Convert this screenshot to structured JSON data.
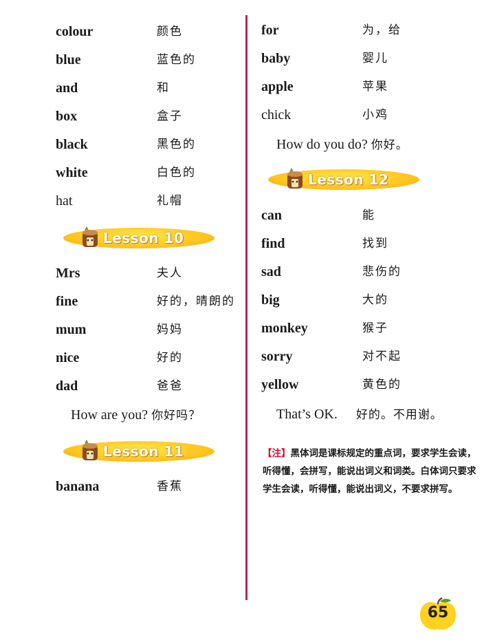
{
  "left_column": {
    "words_top": [
      {
        "en": "colour",
        "zh": "颜色",
        "bold": true
      },
      {
        "en": "blue",
        "zh": "蓝色的",
        "bold": true
      },
      {
        "en": "and",
        "zh": "和",
        "bold": true
      },
      {
        "en": "box",
        "zh": "盒子",
        "bold": true
      },
      {
        "en": "black",
        "zh": "黑色的",
        "bold": true
      },
      {
        "en": "white",
        "zh": "白色的",
        "bold": true
      },
      {
        "en": "hat",
        "zh": "礼帽",
        "bold": false
      }
    ],
    "lesson10": {
      "title": "Lesson 10"
    },
    "words_lesson10": [
      {
        "en": "Mrs",
        "zh": "夫人",
        "bold": true
      },
      {
        "en": "fine",
        "zh": "好的，晴朗的",
        "bold": true
      },
      {
        "en": "mum",
        "zh": "妈妈",
        "bold": true
      },
      {
        "en": "nice",
        "zh": "好的",
        "bold": true
      },
      {
        "en": "dad",
        "zh": "爸爸",
        "bold": true
      }
    ],
    "phrase10": {
      "en": "How are you?",
      "zh": "你好吗？"
    },
    "lesson11": {
      "title": "Lesson 11"
    },
    "words_lesson11": [
      {
        "en": "banana",
        "zh": "香蕉",
        "bold": true
      }
    ]
  },
  "right_column": {
    "words_top": [
      {
        "en": "for",
        "zh": "为，给",
        "bold": true
      },
      {
        "en": "baby",
        "zh": "婴儿",
        "bold": true
      },
      {
        "en": "apple",
        "zh": "苹果",
        "bold": true
      },
      {
        "en": "chick",
        "zh": "小鸡",
        "bold": false
      }
    ],
    "phrase_top": {
      "en": "How do you do?",
      "zh": "你好。"
    },
    "lesson12": {
      "title": "Lesson 12"
    },
    "words_lesson12": [
      {
        "en": "can",
        "zh": "能",
        "bold": true
      },
      {
        "en": "find",
        "zh": "找到",
        "bold": true
      },
      {
        "en": "sad",
        "zh": "悲伤的",
        "bold": true
      },
      {
        "en": "big",
        "zh": "大的",
        "bold": true
      },
      {
        "en": "monkey",
        "zh": "猴子",
        "bold": true
      },
      {
        "en": "sorry",
        "zh": "对不起",
        "bold": true
      },
      {
        "en": "yellow",
        "zh": "黄色的",
        "bold": true
      }
    ],
    "phrase12": {
      "en": "That’s OK.",
      "zh": "好的。不用谢。"
    }
  },
  "note": {
    "tag": "【注】",
    "text": "黑体词是课标规定的重点词，要求学生会读，听得懂，会拼写，能说出词义和词类。白体词只要求学生会读，听得懂，能说出词义，不要求拼写。"
  },
  "page_number": "65",
  "colors": {
    "divider": "#b0284e",
    "lesson_pill": "#ffc21c",
    "note_tag": "#c8102e"
  }
}
